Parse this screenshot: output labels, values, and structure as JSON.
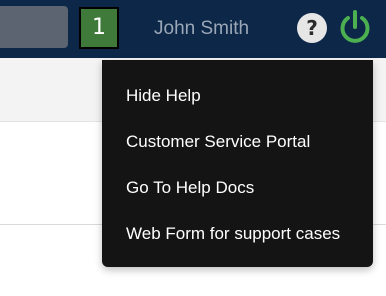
{
  "header": {
    "notification_count": "1",
    "user_name": "John Smith",
    "help_icon": "question-circle-icon",
    "power_icon": "power-icon",
    "accent_green": "#4caf50",
    "bar_color": "#0d2748"
  },
  "help_menu": {
    "items": [
      {
        "label": "Hide Help"
      },
      {
        "label": "Customer Service Portal"
      },
      {
        "label": "Go To Help Docs"
      },
      {
        "label": "Web Form for support cases"
      }
    ]
  }
}
